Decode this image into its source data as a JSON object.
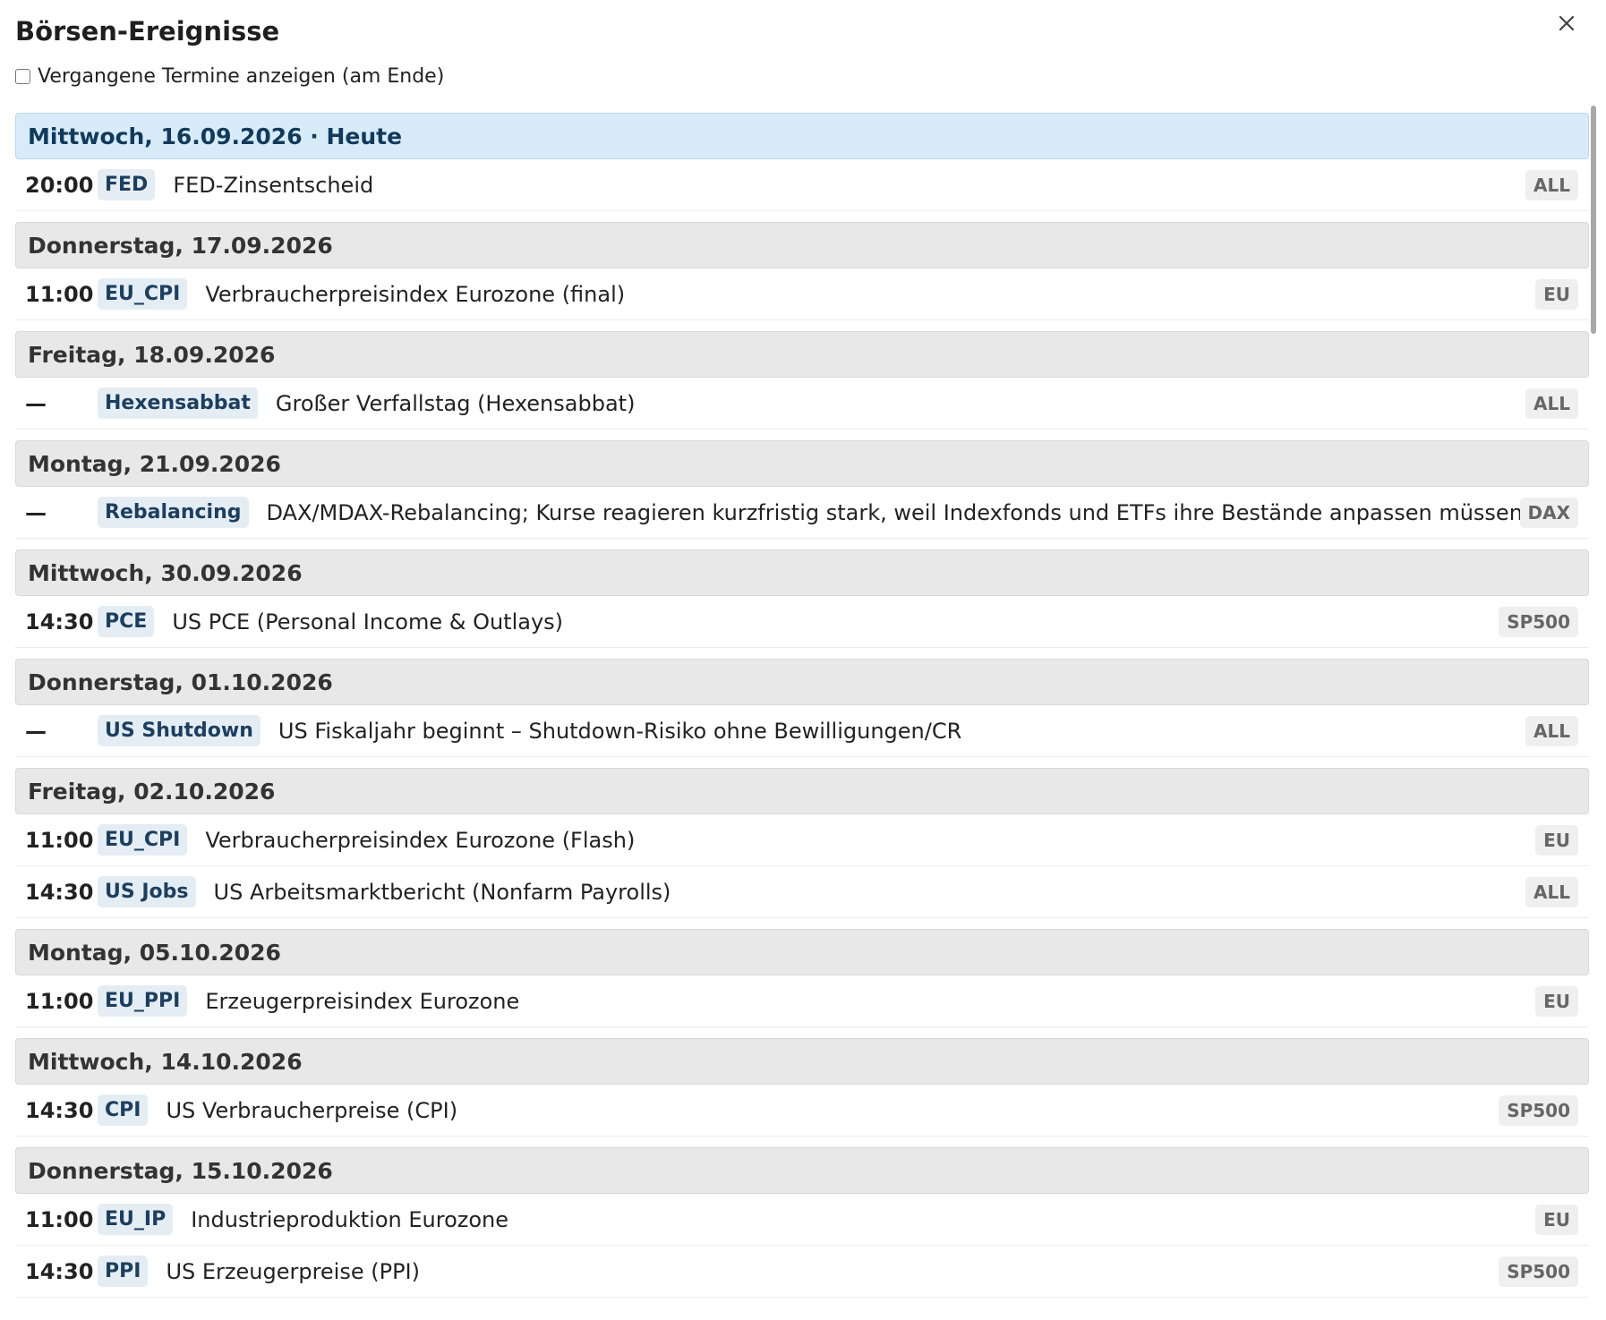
{
  "dialog": {
    "title": "Börsen-Ereignisse",
    "close_icon": "close-icon",
    "show_past": {
      "label": "Vergangene Termine anzeigen (am Ende)",
      "checked": false
    }
  },
  "colors": {
    "today_header_bg": "#d7ebf9",
    "day_header_bg": "#e8e8e8",
    "tag_bg": "#e5edf4",
    "tag_text": "#1c3f60",
    "scope_bg": "#efefef"
  },
  "days": [
    {
      "header": "Mittwoch, 16.09.2026 · Heute",
      "today": true,
      "events": [
        {
          "time": "20:00",
          "tag": "FED",
          "desc": "FED-Zinsentscheid",
          "scope": "ALL"
        }
      ]
    },
    {
      "header": "Donnerstag, 17.09.2026",
      "events": [
        {
          "time": "11:00",
          "tag": "EU_CPI",
          "desc": "Verbraucherpreisindex Eurozone (final)",
          "scope": "EU"
        }
      ]
    },
    {
      "header": "Freitag, 18.09.2026",
      "events": [
        {
          "time": "—",
          "tag": "Hexensabbat",
          "desc": "Großer Verfallstag (Hexensabbat)",
          "scope": "ALL"
        }
      ]
    },
    {
      "header": "Montag, 21.09.2026",
      "events": [
        {
          "time": "—",
          "tag": "Rebalancing",
          "desc": "DAX/MDAX-Rebalancing; Kurse reagieren kurzfristig stark, weil Indexfonds und ETFs ihre Bestände anpassen müssen",
          "scope": "DAX"
        }
      ]
    },
    {
      "header": "Mittwoch, 30.09.2026",
      "events": [
        {
          "time": "14:30",
          "tag": "PCE",
          "desc": "US PCE (Personal Income & Outlays)",
          "scope": "SP500"
        }
      ]
    },
    {
      "header": "Donnerstag, 01.10.2026",
      "events": [
        {
          "time": "—",
          "tag": "US Shutdown",
          "desc": "US Fiskaljahr beginnt – Shutdown-Risiko ohne Bewilligungen/CR",
          "scope": "ALL"
        }
      ]
    },
    {
      "header": "Freitag, 02.10.2026",
      "events": [
        {
          "time": "11:00",
          "tag": "EU_CPI",
          "desc": "Verbraucherpreisindex Eurozone (Flash)",
          "scope": "EU"
        },
        {
          "time": "14:30",
          "tag": "US Jobs",
          "desc": "US Arbeitsmarktbericht (Nonfarm Payrolls)",
          "scope": "ALL"
        }
      ]
    },
    {
      "header": "Montag, 05.10.2026",
      "events": [
        {
          "time": "11:00",
          "tag": "EU_PPI",
          "desc": "Erzeugerpreisindex Eurozone",
          "scope": "EU"
        }
      ]
    },
    {
      "header": "Mittwoch, 14.10.2026",
      "events": [
        {
          "time": "14:30",
          "tag": "CPI",
          "desc": "US Verbraucherpreise (CPI)",
          "scope": "SP500"
        }
      ]
    },
    {
      "header": "Donnerstag, 15.10.2026",
      "events": [
        {
          "time": "11:00",
          "tag": "EU_IP",
          "desc": "Industrieproduktion Eurozone",
          "scope": "EU"
        },
        {
          "time": "14:30",
          "tag": "PPI",
          "desc": "US Erzeugerpreise (PPI)",
          "scope": "SP500"
        }
      ]
    }
  ]
}
